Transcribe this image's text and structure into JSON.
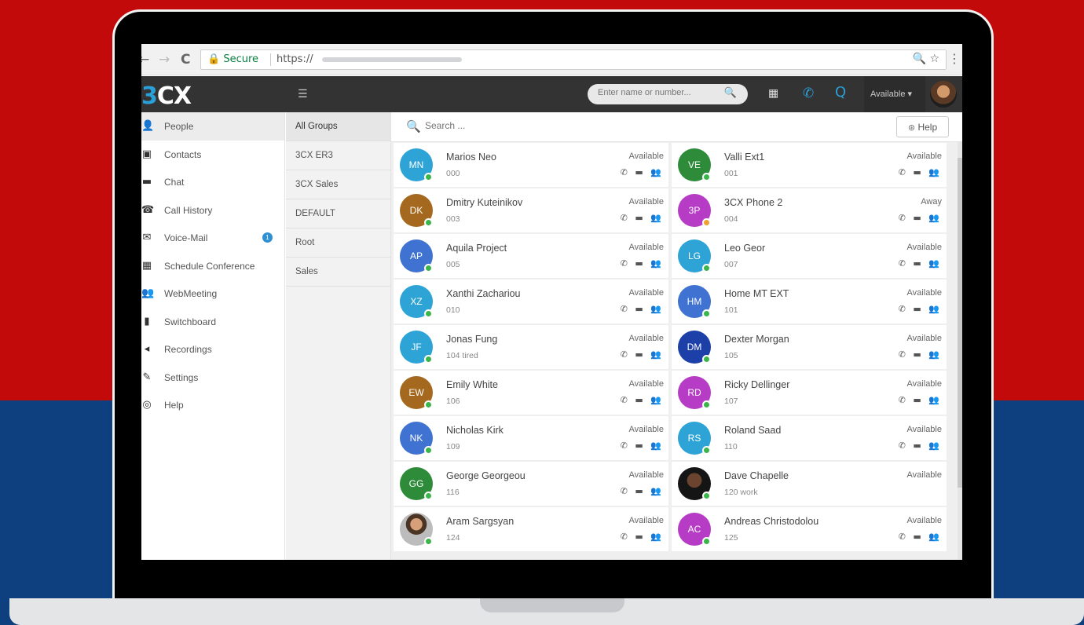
{
  "browser": {
    "back": "←",
    "forward": "→",
    "reload": "C",
    "secure": "🔒 Secure",
    "url": "https://",
    "zoom_icon": "zoom-icon",
    "star_icon": "star-icon",
    "icons_text": "🔍 ☆",
    "menu": "⋮"
  },
  "app": {
    "logo_3": "3",
    "logo_cx": "CX",
    "menu_icon": "☰",
    "search_placeholder": "Enter name or number...",
    "search_icon": "🔍",
    "grid_icon": "▦",
    "phone_icon": "✆",
    "queue_icon": "Q",
    "status": "Available ▾",
    "accent": "#2ba0d8"
  },
  "sidebar": {
    "items": [
      {
        "icon": "👤",
        "icon_name": "person-icon",
        "label": "People"
      },
      {
        "icon": "▣",
        "icon_name": "contacts-icon",
        "label": "Contacts"
      },
      {
        "icon": "▬",
        "icon_name": "chat-icon",
        "label": "Chat"
      },
      {
        "icon": "☎",
        "icon_name": "call-history-icon",
        "label": "Call History"
      },
      {
        "icon": "✉",
        "icon_name": "voicemail-icon",
        "label": "Voice-Mail",
        "badge": "1"
      },
      {
        "icon": "▦",
        "icon_name": "calendar-icon",
        "label": "Schedule Conference"
      },
      {
        "icon": "👥",
        "icon_name": "webmeeting-icon",
        "label": "WebMeeting"
      },
      {
        "icon": "▮",
        "icon_name": "switchboard-icon",
        "label": "Switchboard"
      },
      {
        "icon": "◂",
        "icon_name": "recordings-icon",
        "label": "Recordings"
      },
      {
        "icon": "✎",
        "icon_name": "settings-icon",
        "label": "Settings"
      },
      {
        "icon": "◎",
        "icon_name": "help-icon",
        "label": "Help"
      }
    ]
  },
  "groups": [
    "All Groups",
    "3CX ER3",
    "3CX Sales",
    "DEFAULT",
    "Root",
    "Sales"
  ],
  "main": {
    "search_icon": "🔍",
    "search_placeholder": "Search ...",
    "help_icon": "⊛",
    "help_label": "Help",
    "actions": "✆ ▬ 👥"
  },
  "contacts": [
    {
      "initials": "MN",
      "name": "Marios Neo",
      "ext": "000",
      "status": "Available",
      "color": "#2ea3d5",
      "dot": "#3bb54a"
    },
    {
      "initials": "VE",
      "name": "Valli Ext1",
      "ext": "001",
      "status": "Available",
      "color": "#2e8b3a",
      "dot": "#3bb54a"
    },
    {
      "initials": "DK",
      "name": "Dmitry Kuteinikov",
      "ext": "003",
      "status": "Available",
      "color": "#a4691e",
      "dot": "#3bb54a"
    },
    {
      "initials": "3P",
      "name": "3CX Phone 2",
      "ext": "004",
      "status": "Away",
      "color": "#b73cc5",
      "dot": "#f0a030"
    },
    {
      "initials": "AP",
      "name": "Aquila Project",
      "ext": "005",
      "status": "Available",
      "color": "#3f72d1",
      "dot": "#3bb54a"
    },
    {
      "initials": "LG",
      "name": "Leo Geor",
      "ext": "007",
      "status": "Available",
      "color": "#2ea3d5",
      "dot": "#3bb54a"
    },
    {
      "initials": "XZ",
      "name": "Xanthi Zachariou",
      "ext": "010",
      "status": "Available",
      "color": "#2ea3d5",
      "dot": "#3bb54a"
    },
    {
      "initials": "HM",
      "name": "Home MT EXT",
      "ext": "101",
      "status": "Available",
      "color": "#3f72d1",
      "dot": "#3bb54a"
    },
    {
      "initials": "JF",
      "name": "Jonas Fung",
      "ext": "104 tired",
      "status": "Available",
      "color": "#2ea3d5",
      "dot": "#3bb54a"
    },
    {
      "initials": "DM",
      "name": "Dexter Morgan",
      "ext": "105",
      "status": "Available",
      "color": "#1d3fa8",
      "dot": "#3bb54a"
    },
    {
      "initials": "EW",
      "name": "Emily White",
      "ext": "106",
      "status": "Available",
      "color": "#a4691e",
      "dot": "#3bb54a"
    },
    {
      "initials": "RD",
      "name": "Ricky Dellinger",
      "ext": "107",
      "status": "Available",
      "color": "#b73cc5",
      "dot": "#3bb54a"
    },
    {
      "initials": "NK",
      "name": "Nicholas Kirk",
      "ext": "109",
      "status": "Available",
      "color": "#3f72d1",
      "dot": "#3bb54a"
    },
    {
      "initials": "RS",
      "name": "Roland Saad",
      "ext": "110",
      "status": "Available",
      "color": "#2ea3d5",
      "dot": "#3bb54a"
    },
    {
      "initials": "GG",
      "name": "George Georgeou",
      "ext": "116",
      "status": "Available",
      "color": "#2e8b3a",
      "dot": "#3bb54a"
    },
    {
      "initials": "",
      "name": "Dave Chapelle",
      "ext": "120 work",
      "status": "Available",
      "color": "#151515",
      "dot": "#3bb54a",
      "photo": true,
      "no_actions": true
    },
    {
      "initials": "",
      "name": "Aram Sargsyan",
      "ext": "124",
      "status": "Available",
      "color": "#bcbcbc",
      "dot": "#3bb54a",
      "photo": true
    },
    {
      "initials": "AC",
      "name": "Andreas Christodolou",
      "ext": "125",
      "status": "Available",
      "color": "#b73cc5",
      "dot": "#3bb54a"
    }
  ]
}
